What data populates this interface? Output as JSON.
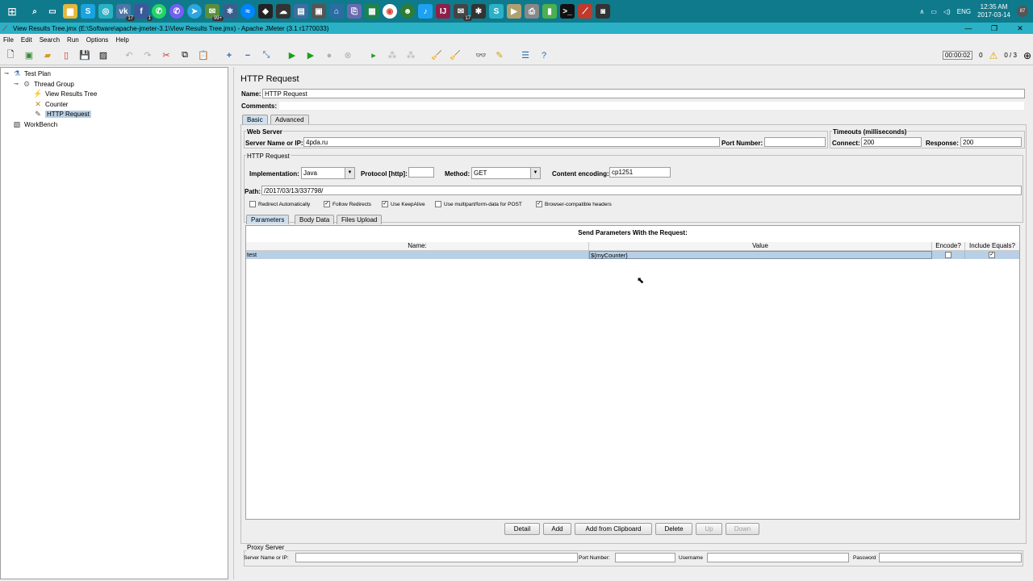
{
  "taskbar": {
    "clock_time": "12:35 AM",
    "clock_date": "2017-03-14",
    "lang": "ENG",
    "notif_count": "87",
    "badges": {
      "vk": "17",
      "fb": "1",
      "sk99": "99+",
      "mail": "17"
    }
  },
  "window": {
    "title": "View Results Tree.jmx (E:\\Software\\apache-jmeter-3.1\\View Results Tree.jmx) - Apache JMeter (3.1 r1770033)"
  },
  "menu": [
    "File",
    "Edit",
    "Search",
    "Run",
    "Options",
    "Help"
  ],
  "toolbar": {
    "timer": "00:00:02",
    "warnings": "0",
    "threads": "0 / 3"
  },
  "tree": {
    "items": [
      {
        "label": "Test Plan",
        "icon": "test-plan-icon"
      },
      {
        "label": "Thread Group",
        "icon": "thread-group-icon"
      },
      {
        "label": "View Results Tree",
        "icon": "results-tree-icon"
      },
      {
        "label": "Counter",
        "icon": "counter-icon"
      },
      {
        "label": "HTTP Request",
        "icon": "http-request-icon"
      },
      {
        "label": "WorkBench",
        "icon": "workbench-icon"
      }
    ]
  },
  "panel": {
    "title": "HTTP Request",
    "name_label": "Name:",
    "name_value": "HTTP Request",
    "comments_label": "Comments:",
    "tabs": [
      "Basic",
      "Advanced"
    ],
    "web_server": {
      "legend": "Web Server",
      "server_label": "Server Name or IP:",
      "server_value": "4pda.ru",
      "port_label": "Port Number:",
      "port_value": ""
    },
    "timeouts": {
      "legend": "Timeouts (milliseconds)",
      "connect_label": "Connect:",
      "connect_value": "200",
      "response_label": "Response:",
      "response_value": "200"
    },
    "http_request": {
      "legend": "HTTP Request",
      "impl_label": "Implementation:",
      "impl_value": "Java",
      "protocol_label": "Protocol [http]:",
      "protocol_value": "",
      "method_label": "Method:",
      "method_value": "GET",
      "encoding_label": "Content encoding:",
      "encoding_value": "cp1251",
      "path_label": "Path:",
      "path_value": "/2017/03/13/337798/"
    },
    "checkboxes": [
      {
        "label": "Redirect Automatically",
        "checked": false
      },
      {
        "label": "Follow Redirects",
        "checked": true
      },
      {
        "label": "Use KeepAlive",
        "checked": true
      },
      {
        "label": "Use multipart/form-data for POST",
        "checked": false
      },
      {
        "label": "Browser-compatible headers",
        "checked": true
      }
    ],
    "subtabs": [
      "Parameters",
      "Body Data",
      "Files Upload"
    ],
    "params": {
      "caption": "Send Parameters With the Request:",
      "headers": [
        "Name:",
        "Value",
        "Encode?",
        "Include Equals?"
      ],
      "rows": [
        {
          "name": "test",
          "value": "${myCounter}",
          "encode": false,
          "include_equals": true
        }
      ]
    },
    "buttons": {
      "detail": "Detail",
      "add": "Add",
      "add_clip": "Add from Clipboard",
      "delete": "Delete",
      "up": "Up",
      "down": "Down"
    },
    "proxy": {
      "legend": "Proxy Server",
      "server_label": "Server Name or IP:",
      "port_label": "Port Number:",
      "user_label": "Username",
      "pass_label": "Password"
    }
  },
  "colors": {
    "taskbar": "#0f7a8c",
    "titlebar": "#2ab1c6",
    "selection": "#b8cfe5"
  }
}
